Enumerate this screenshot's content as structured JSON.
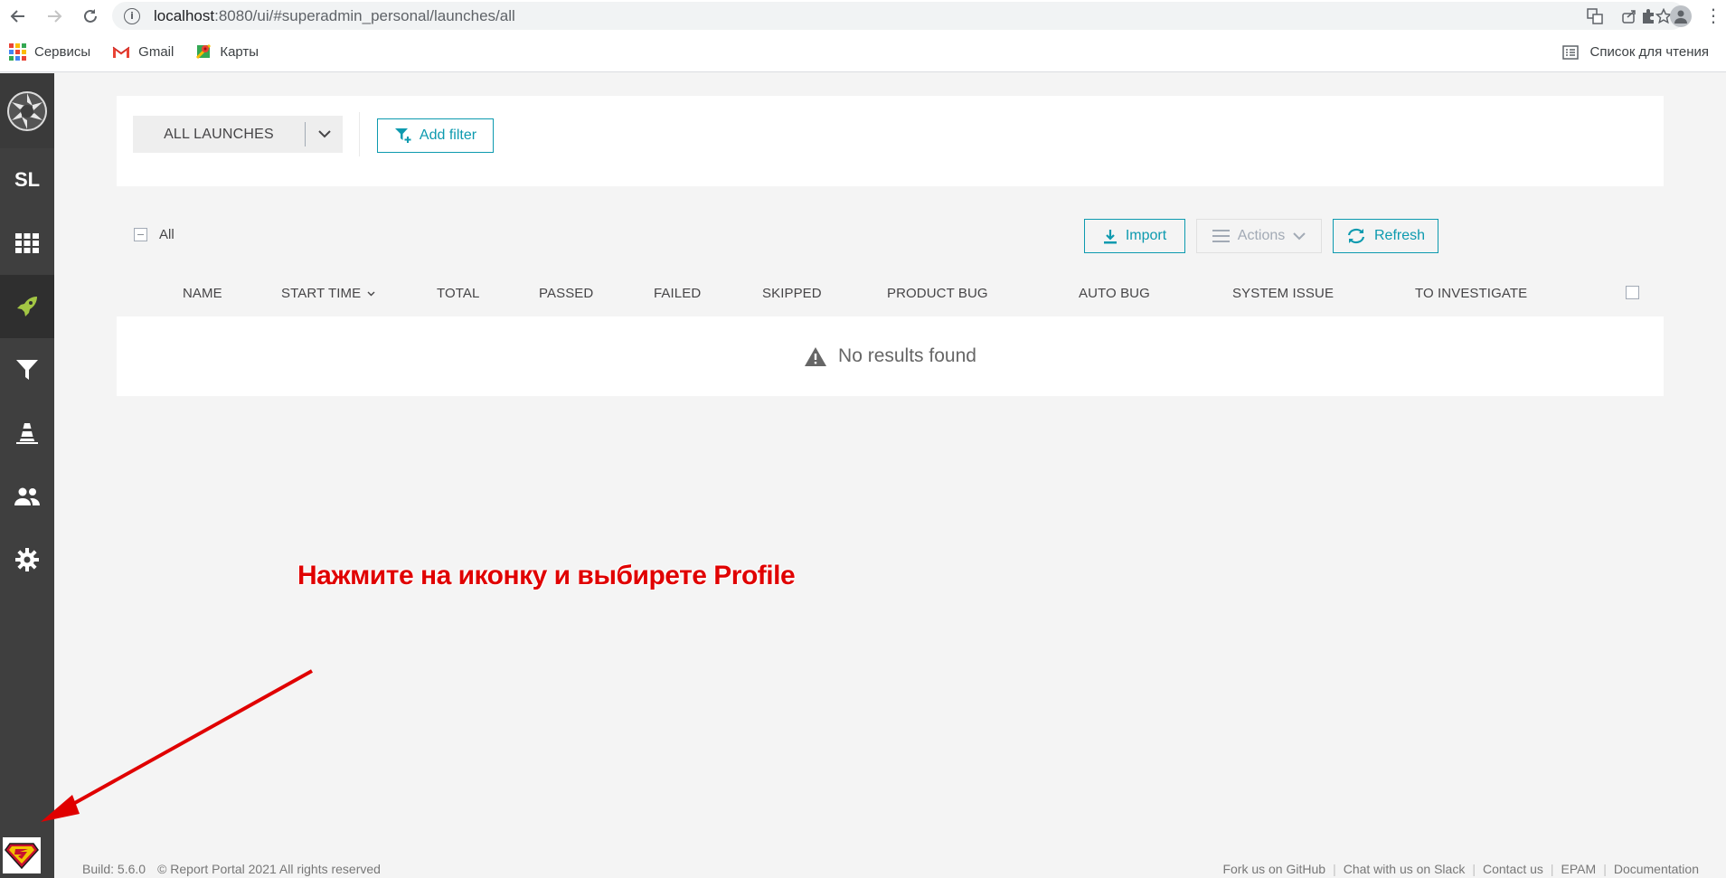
{
  "browser": {
    "url_host": "localhost",
    "url_rest": ":8080/ui/#superadmin_personal/launches/all"
  },
  "bookmarks": {
    "items": [
      {
        "label": "Сервисы",
        "icon": "apps-grid-icon"
      },
      {
        "label": "Gmail",
        "icon": "gmail-icon"
      },
      {
        "label": "Карты",
        "icon": "maps-icon"
      }
    ],
    "reading_list": "Список для чтения"
  },
  "sidebar": {
    "project_initials": "SL",
    "items": [
      {
        "icon": "dashboard-grid-icon"
      },
      {
        "icon": "rocket-icon"
      },
      {
        "icon": "filter-icon"
      },
      {
        "icon": "debug-cone-icon"
      },
      {
        "icon": "members-icon"
      },
      {
        "icon": "settings-gear-icon"
      }
    ],
    "active_item": "rocket-icon",
    "active_color": "#a3c644"
  },
  "filter_bar": {
    "launch_select_label": "ALL LAUNCHES",
    "add_filter_label": "Add filter"
  },
  "toolbar": {
    "select_all_label": "All",
    "import_label": "Import",
    "actions_label": "Actions",
    "refresh_label": "Refresh"
  },
  "table": {
    "columns": [
      "NAME",
      "START TIME",
      "TOTAL",
      "PASSED",
      "FAILED",
      "SKIPPED",
      "PRODUCT BUG",
      "AUTO BUG",
      "SYSTEM ISSUE",
      "TO INVESTIGATE"
    ],
    "sorted_column": "START TIME",
    "empty_message": "No results found"
  },
  "annotation": {
    "text": "Нажмите на иконку и выбирете Profile",
    "color": "#e00000"
  },
  "footer": {
    "build": "Build: 5.6.0",
    "copyright": "© Report Portal 2021 All rights reserved",
    "links": [
      "Fork us on GitHub",
      "Chat with us on Slack",
      "Contact us",
      "EPAM",
      "Documentation"
    ]
  },
  "colors": {
    "accent": "#0d9aaf",
    "sidebar_bg": "#3f3f3f",
    "page_bg": "#f4f4f4"
  }
}
